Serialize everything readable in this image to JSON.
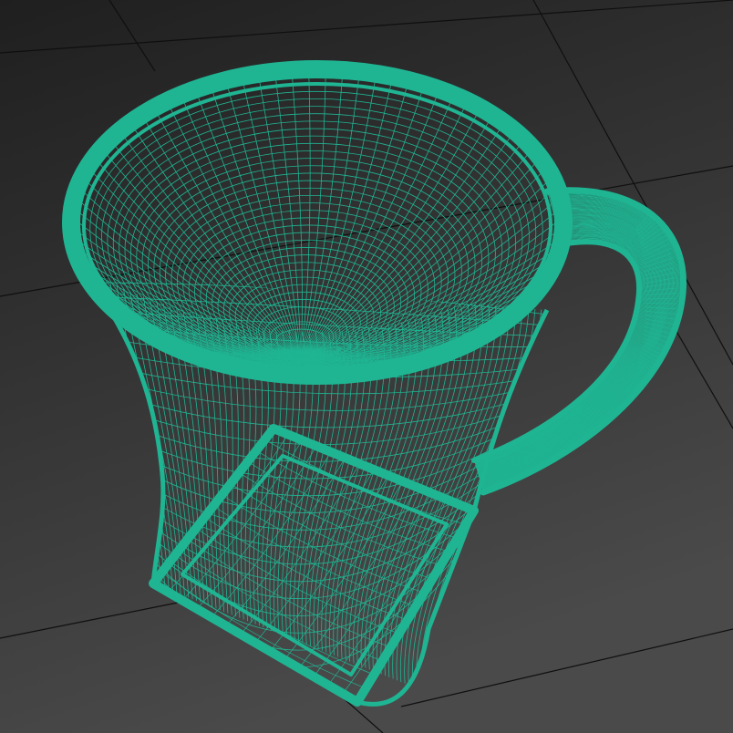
{
  "viewport": {
    "background_top": "#1f1f1f",
    "background_bottom": "#4a4a4a",
    "grid_color": "#0f0f0f"
  },
  "model": {
    "object": "cup-wireframe",
    "display_mode": "wireframe",
    "wire_color": "#1fb593",
    "wire_color_dark": "#159078"
  }
}
